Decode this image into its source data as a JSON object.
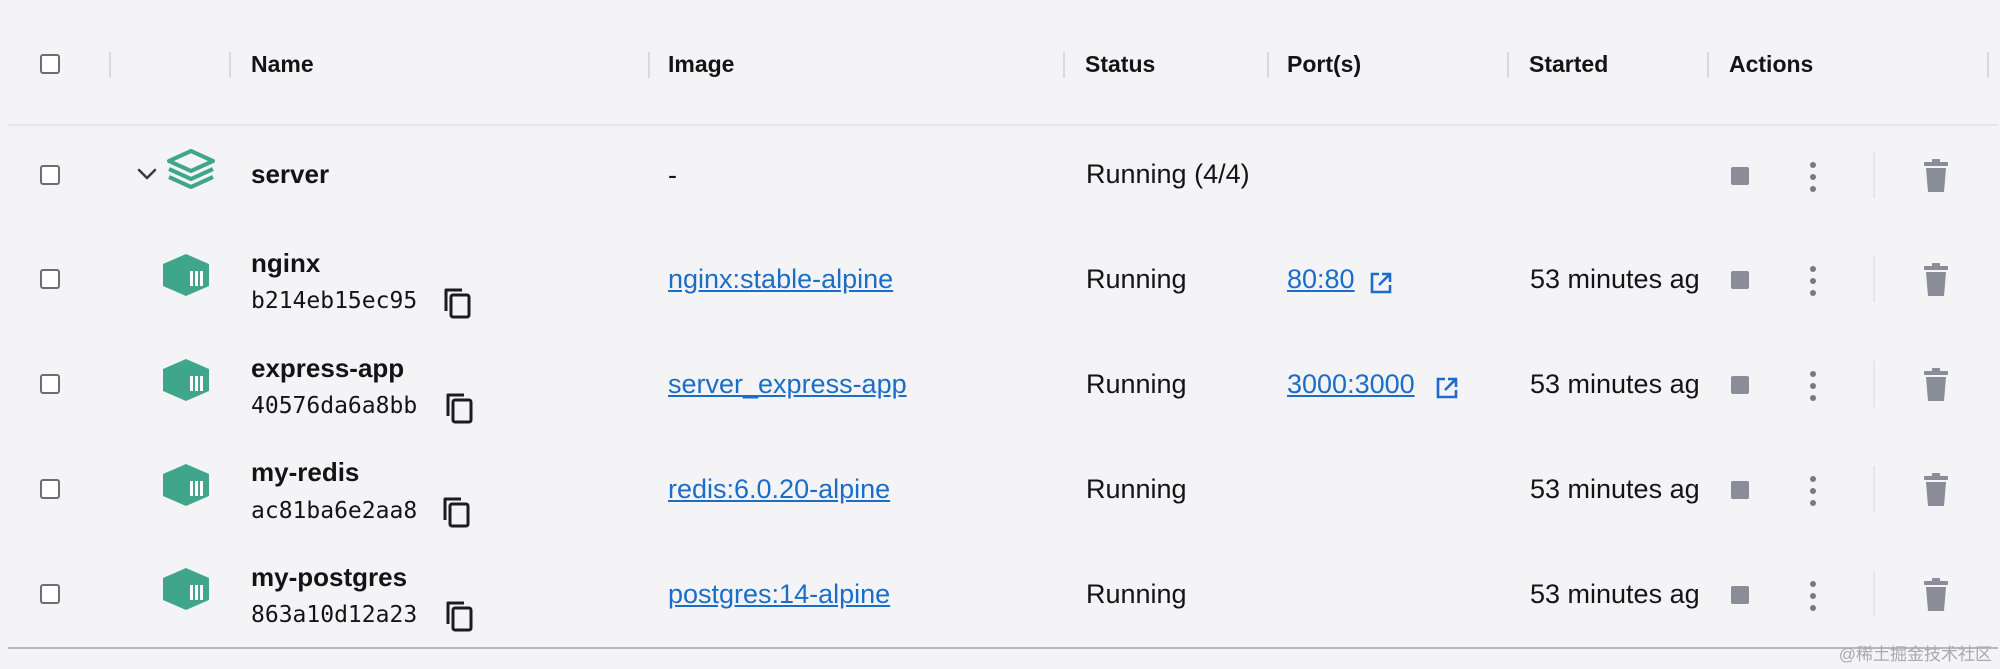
{
  "header": {
    "name": "Name",
    "image": "Image",
    "status": "Status",
    "ports": "Port(s)",
    "started": "Started",
    "actions": "Actions"
  },
  "group": {
    "name": "server",
    "image": "-",
    "status": "Running (4/4)"
  },
  "containers": [
    {
      "name": "nginx",
      "id": "b214eb15ec95",
      "image": "nginx:stable-alpine",
      "status": "Running",
      "ports": "80:80",
      "started": "53 minutes ag"
    },
    {
      "name": "express-app",
      "id": "40576da6a8bb",
      "image": "server_express-app",
      "status": "Running",
      "ports": "3000:3000",
      "started": "53 minutes ag"
    },
    {
      "name": "my-redis",
      "id": "ac81ba6e2aa8",
      "image": "redis:6.0.20-alpine",
      "status": "Running",
      "ports": "",
      "started": "53 minutes ag"
    },
    {
      "name": "my-postgres",
      "id": "863a10d12a23",
      "image": "postgres:14-alpine",
      "status": "Running",
      "ports": "",
      "started": "53 minutes ag"
    }
  ],
  "watermark": "@稀土掘金技术社区",
  "colors": {
    "accent": "#3fa68b",
    "link": "#1a6dc9",
    "action_icon": "#8a8d97"
  },
  "icons": {
    "group": "stack-layers-icon",
    "container": "container-box-icon",
    "copy": "copy-icon",
    "external": "external-link-icon",
    "stop": "stop-icon",
    "menu": "kebab-menu-icon",
    "delete": "trash-icon",
    "expand": "chevron-down-icon"
  }
}
